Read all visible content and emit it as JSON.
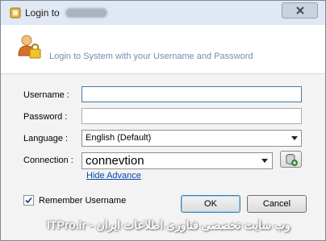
{
  "window": {
    "title": "Login to",
    "close_icon": "close-icon"
  },
  "header": {
    "icon": "user-lock-icon",
    "text": "Login to System with your Username and Password"
  },
  "form": {
    "username": {
      "label": "Username :",
      "value": ""
    },
    "password": {
      "label": "Password :",
      "value": ""
    },
    "language": {
      "label": "Language :",
      "selected": "English (Default)"
    },
    "connection": {
      "label": "Connection :",
      "selected": "connevtion",
      "db_icon": "database-add-icon"
    },
    "hide_advance": "Hide Advance"
  },
  "footer": {
    "remember_label": "Remember Username",
    "remember_checked": true,
    "ok_label": "OK",
    "cancel_label": "Cancel"
  },
  "watermark": "ITPro.ir - وب سایت تخصصی فناوری اطلاعات ایران"
}
